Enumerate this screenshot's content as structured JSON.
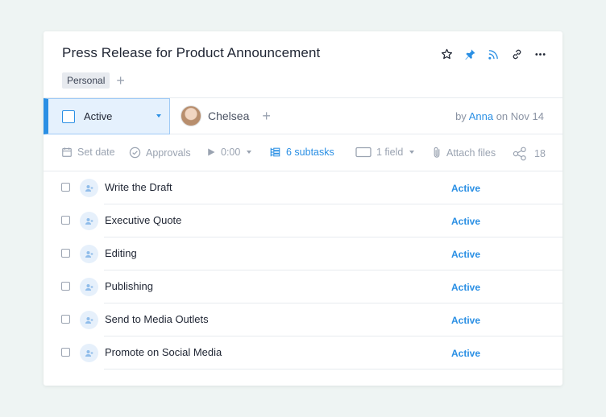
{
  "task": {
    "title": "Press Release for Product Announcement",
    "tags": [
      "Personal"
    ]
  },
  "header_icons": [
    "star-icon",
    "pin-icon",
    "rss-icon",
    "link-icon",
    "more-icon"
  ],
  "status_bar": {
    "status": "Active",
    "assignee": "Chelsea",
    "by_prefix": "by",
    "author": "Anna",
    "on_prefix": "on",
    "date": "Nov 14"
  },
  "toolbar": {
    "set_date": "Set date",
    "approvals": "Approvals",
    "timer": "0:00",
    "subtasks": "6 subtasks",
    "field": "1 field",
    "attach": "Attach files",
    "share_count": "18"
  },
  "subtasks": [
    {
      "name": "Write the Draft",
      "status": "Active"
    },
    {
      "name": "Executive Quote",
      "status": "Active"
    },
    {
      "name": "Editing",
      "status": "Active"
    },
    {
      "name": "Publishing",
      "status": "Active"
    },
    {
      "name": "Send to Media Outlets",
      "status": "Active"
    },
    {
      "name": "Promote on Social Media",
      "status": "Active"
    }
  ],
  "colors": {
    "accent": "#2a8fe4",
    "background": "#eef4f3",
    "status_bg": "#e5f1fd"
  }
}
